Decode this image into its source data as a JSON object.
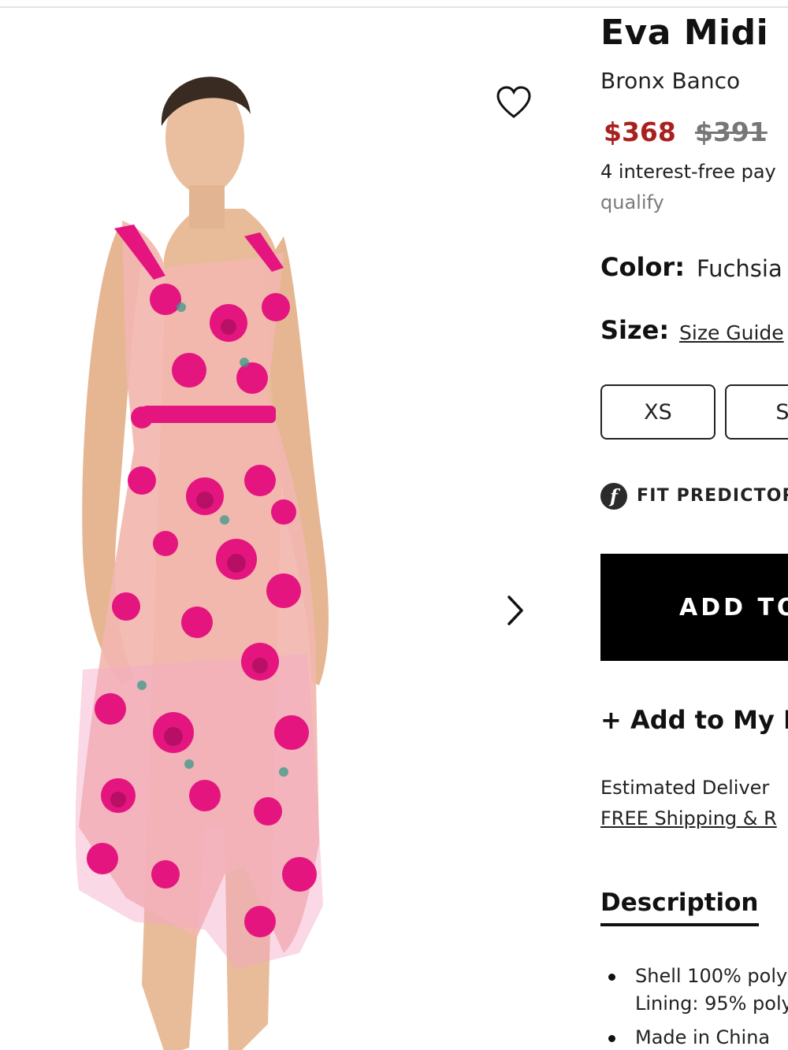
{
  "product": {
    "title": "Eva Midi",
    "brand": "Bronx Banco",
    "price_sale": "$368",
    "price_original": "$391",
    "installments_line1": "4 interest-free pay",
    "installments_line2": "qualify",
    "color_label": "Color:",
    "color_value": "Fuchsia",
    "size_label": "Size:",
    "size_guide": "Size Guide",
    "sizes": [
      "XS",
      "S"
    ],
    "fit_predictor": "FIT PREDICTOR",
    "add_to_bag": "ADD TO",
    "add_to_list": "+ Add to My L",
    "estimated_delivery": "Estimated Deliver",
    "free_shipping": "FREE Shipping & R",
    "description_tab": "Description",
    "description_items": [
      "Shell 100% poly",
      "Lining: 95% poly",
      "Made in China"
    ]
  },
  "colors": {
    "sale_price": "#a8211e",
    "original_price": "#777777",
    "button_bg": "#000000",
    "dress_pink": "#e5157f",
    "dress_base": "#f3b8b3"
  },
  "icons": {
    "wishlist": "heart-outline-icon",
    "next": "chevron-right-icon",
    "fit": "fit-predictor-logo-icon"
  }
}
